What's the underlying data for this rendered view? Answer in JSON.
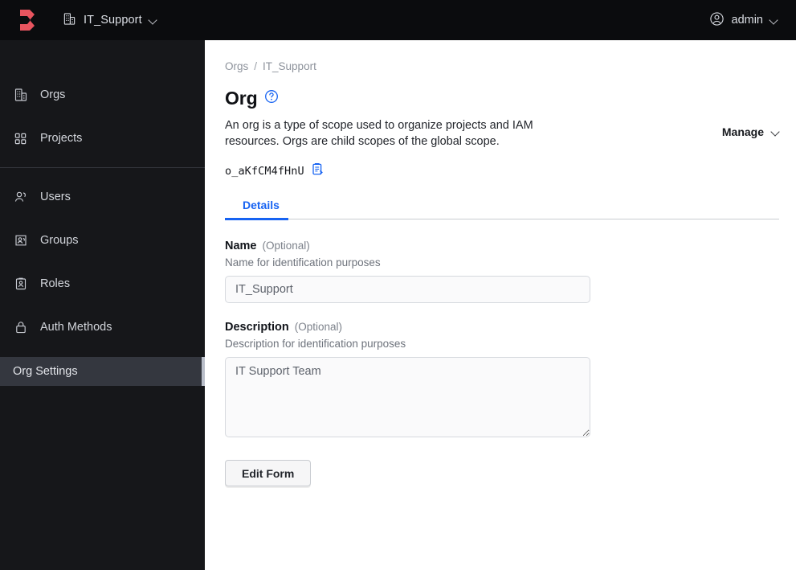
{
  "topbar": {
    "logo_icon": "boundary-logo-icon",
    "logo_color": "#e8555f",
    "scope_icon": "building-icon",
    "scope_label": "IT_Support",
    "scope_chevron_icon": "chevron-down-icon",
    "user_icon": "user-circle-icon",
    "user_label": "admin",
    "user_chevron_icon": "chevron-down-icon",
    "background": "#0b0c0e"
  },
  "sidebar": {
    "background": "#16171a",
    "items": [
      {
        "label": "Orgs",
        "icon": "building-icon"
      },
      {
        "label": "Projects",
        "icon": "grid-icon"
      },
      {
        "label": "Users",
        "icon": "users-icon"
      },
      {
        "label": "Groups",
        "icon": "user-group-icon"
      },
      {
        "label": "Roles",
        "icon": "id-badge-icon"
      },
      {
        "label": "Auth Methods",
        "icon": "lock-icon"
      }
    ],
    "settings": {
      "label": "Org Settings",
      "active": true,
      "active_bg": "#34373f",
      "active_bar": "#b9bec9"
    }
  },
  "breadcrumb": {
    "root": "Orgs",
    "separator": "/",
    "current": "IT_Support"
  },
  "page": {
    "title": "Org",
    "help_icon": "question-circle-icon",
    "help_color": "#1763f2",
    "description": "An org is a type of scope used to organize projects and IAM resources. Orgs are child scopes of the global scope.",
    "manage_label": "Manage",
    "manage_chevron_icon": "chevron-down-icon",
    "id": "o_aKfCM4fHnU",
    "copy_icon": "clipboard-copy-icon",
    "copy_color": "#1763f2"
  },
  "tabs": {
    "items": [
      {
        "label": "Details",
        "active": true
      }
    ],
    "active_color": "#1763f2"
  },
  "form": {
    "name": {
      "label": "Name",
      "optional": "(Optional)",
      "help": "Name for identification purposes",
      "value": "IT_Support",
      "placeholder": "Name"
    },
    "description": {
      "label": "Description",
      "optional": "(Optional)",
      "help": "Description for identification purposes",
      "value": "IT Support Team",
      "placeholder": "Description"
    },
    "edit_button": "Edit Form"
  }
}
